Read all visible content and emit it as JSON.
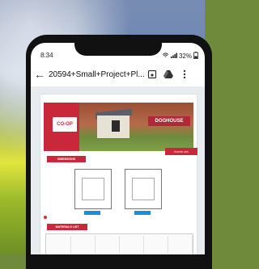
{
  "status": {
    "time": "8:34",
    "battery": "32%"
  },
  "appbar": {
    "title": "20594+Small+Project+Pl..."
  },
  "document": {
    "brand": "CO-OP",
    "product_title": "DOGHOUSE",
    "website": "fcome.ors",
    "section_title": "DIMENSIONS",
    "materials_title": "MATERIALS LIST"
  },
  "icons": {
    "back": "arrow-left-icon",
    "save": "save-icon",
    "drive": "drive-icon",
    "more": "more-vert-icon",
    "wifi": "wifi-icon",
    "signal": "signal-icon",
    "battery": "battery-icon"
  },
  "colors": {
    "brand_red": "#c9283a",
    "accent_blue": "#1a8fd8"
  }
}
